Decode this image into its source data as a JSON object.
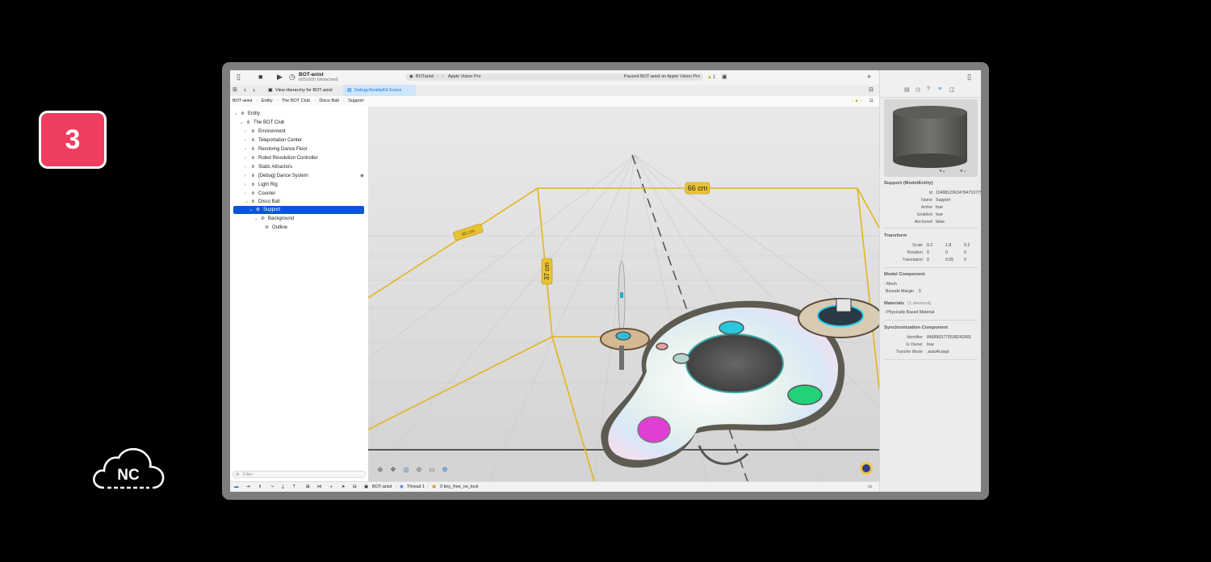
{
  "badge": {
    "number": "3"
  },
  "logo": {
    "text": "NC"
  },
  "toolbar": {
    "scheme_name": "BOT-anist",
    "scheme_sub": "b05c600 (detached)",
    "run_target_app": "BOTanist",
    "run_target_device": "Apple Vision Pro",
    "status": "Paused BOT-anist on Apple Vision Pro",
    "warning_count": "1",
    "add_label": "+"
  },
  "tabs": [
    {
      "label": "View Hierarchy for BOT-anist"
    },
    {
      "label": "Debug-RealityKit.Scene"
    }
  ],
  "breadcrumb": [
    "BOT-anist",
    "Entity",
    "The BOT Club",
    "Disco Ball",
    "Support"
  ],
  "tree": [
    {
      "label": "Entity"
    },
    {
      "label": "The BOT Club"
    },
    {
      "label": "Environment"
    },
    {
      "label": "Teleportation Center"
    },
    {
      "label": "Revolving Dance Floor"
    },
    {
      "label": "Robot Revolution Controller"
    },
    {
      "label": "Static Attractors"
    },
    {
      "label": "[Debug] Dance System"
    },
    {
      "label": "Light Rig"
    },
    {
      "label": "Counter"
    },
    {
      "label": "Disco Ball"
    },
    {
      "label": "Support"
    },
    {
      "label": "Background"
    },
    {
      "label": "Outline"
    }
  ],
  "filter_placeholder": "Filter",
  "viewport": {
    "dim_width": "66 cm",
    "dim_height": "37 cm",
    "dim_depth": "65 cm"
  },
  "debugbar": {
    "target": "BOT-anist",
    "thread": "Thread 1",
    "frame": "0 tiny_free_no_lock"
  },
  "inspector": {
    "title": "Support (ModelEntity)",
    "entity": [
      {
        "k": "Id",
        "v": "10498129634784719775"
      },
      {
        "k": "Name",
        "v": "Support"
      },
      {
        "k": "Active",
        "v": "true"
      },
      {
        "k": "Enabled",
        "v": "true"
      },
      {
        "k": "Anchored",
        "v": "false"
      }
    ],
    "transform_title": "Transform",
    "transform": [
      {
        "k": "Scale",
        "v": [
          "0.2",
          "1.8",
          "0.2"
        ]
      },
      {
        "k": "Rotation",
        "v": [
          "0",
          "0",
          "0"
        ]
      },
      {
        "k": "Translation",
        "v": [
          "0",
          "0.05",
          "0"
        ]
      }
    ],
    "model_title": "Model Component",
    "mesh_label": "Mesh",
    "bounds_label": "Bounds Margin",
    "bounds_value": "0",
    "materials_title": "Materials",
    "materials_count": "(1 element)",
    "material_item": "Physically Based Material",
    "sync_title": "Synchronization Component",
    "sync": [
      {
        "k": "Identifier",
        "v": "8468903776538242065"
      },
      {
        "k": "Is Owner",
        "v": "true"
      },
      {
        "k": "Transfer Mode",
        "v": ".autoAccept"
      }
    ]
  },
  "colors": {
    "badge": "#ee3d5f",
    "selection": "#0a56d6",
    "bounds_yellow": "#e2b51c",
    "accent_tab": "#cfe6fa"
  }
}
